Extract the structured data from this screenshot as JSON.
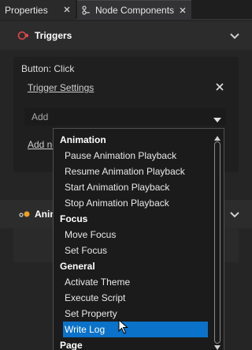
{
  "tabs": [
    {
      "label": "Properties",
      "active": false
    },
    {
      "label": "Node Components",
      "active": true
    }
  ],
  "triggers_section": {
    "title": "Triggers"
  },
  "trigger_card": {
    "title": "Button: Click",
    "settings_link": "Trigger Settings",
    "add_field_placeholder": "Add",
    "add_link": "Add new action"
  },
  "second_section": {
    "title": "Animations"
  },
  "dropdown": {
    "items": [
      {
        "type": "category",
        "label": "Animation"
      },
      {
        "type": "option",
        "label": "Pause Animation Playback"
      },
      {
        "type": "option",
        "label": "Resume Animation Playback"
      },
      {
        "type": "option",
        "label": "Start Animation Playback"
      },
      {
        "type": "option",
        "label": "Stop Animation Playback"
      },
      {
        "type": "category",
        "label": "Focus"
      },
      {
        "type": "option",
        "label": "Move Focus"
      },
      {
        "type": "option",
        "label": "Set Focus"
      },
      {
        "type": "category",
        "label": "General"
      },
      {
        "type": "option",
        "label": "Activate Theme"
      },
      {
        "type": "option",
        "label": "Execute Script"
      },
      {
        "type": "option",
        "label": "Set Property"
      },
      {
        "type": "option",
        "label": "Write Log",
        "selected": true
      },
      {
        "type": "category",
        "label": "Page"
      }
    ]
  },
  "colors": {
    "selection": "#0a72c8",
    "trigger_icon": "#e04848",
    "animation_icon": "#f0a020"
  }
}
